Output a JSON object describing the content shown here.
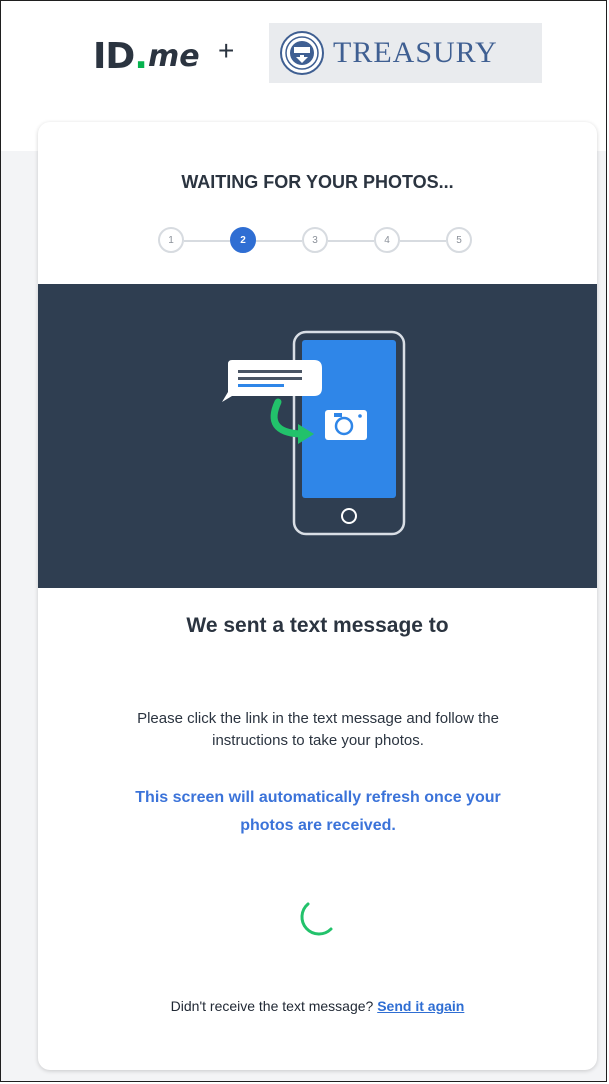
{
  "header": {
    "idme_logo": {
      "id": "ID",
      "dot": ".",
      "me": "me"
    },
    "plus": "+",
    "partner_logo": "TREASURY"
  },
  "card": {
    "title": "WAITING FOR YOUR PHOTOS...",
    "steps": [
      "1",
      "2",
      "3",
      "4",
      "5"
    ],
    "active_step": 2,
    "heading": "We sent a text message to",
    "instructions": "Please click the link in the text message and follow the instructions to take your photos.",
    "refresh_note": "This screen will automatically refresh once your photos are received.",
    "resend_prompt": "Didn't receive the text message?",
    "resend_link": "Send it again"
  },
  "icons": {
    "illustration": "phone-text-message-camera-illustration",
    "spinner": "loading-spinner-icon",
    "seal": "treasury-seal-icon"
  },
  "colors": {
    "brand_green": "#06b34f",
    "accent_blue": "#2f6ed3",
    "panel_dark": "#2f3e51",
    "note_blue": "#3b73d9"
  }
}
